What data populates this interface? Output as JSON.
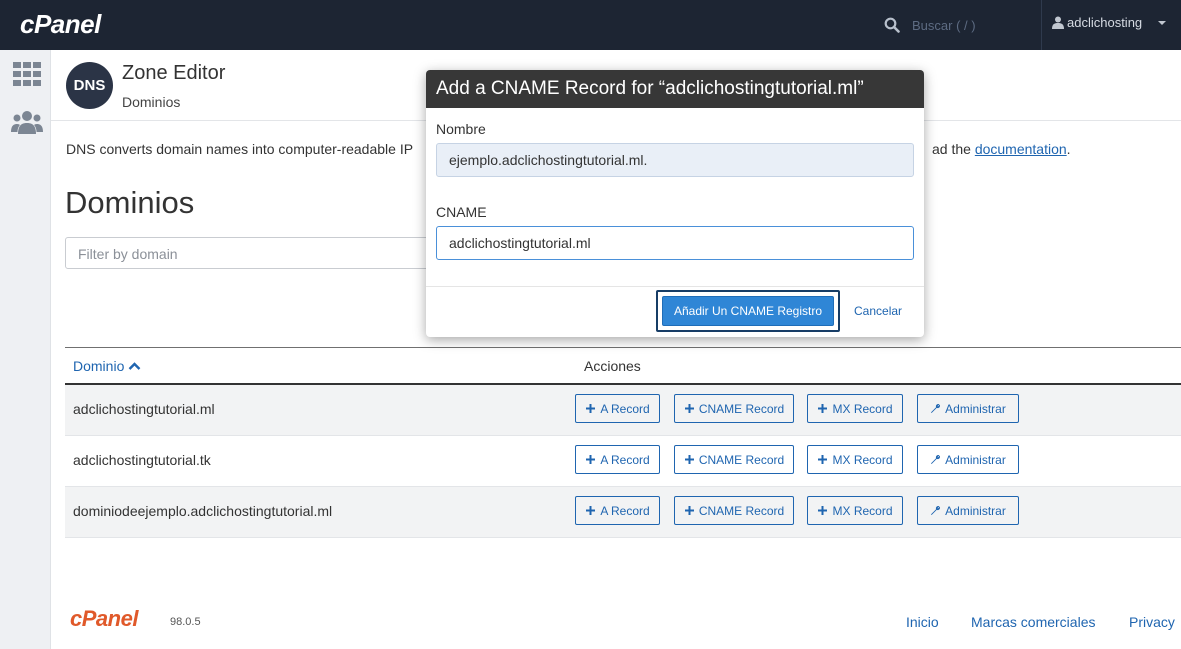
{
  "topbar": {
    "logo": "cPanel",
    "search_placeholder": "Buscar ( / )",
    "username": "adclichosting"
  },
  "sidebar": {
    "items": [
      {
        "icon": "grid-icon"
      },
      {
        "icon": "users-icon"
      }
    ]
  },
  "header": {
    "dns_badge": "DNS",
    "title": "Zone Editor",
    "subtitle": "Dominios"
  },
  "intro": {
    "text_start": "DNS converts domain names into computer-readable IP",
    "text_end_prefix": "ad the ",
    "link": "documentation",
    "text_end_suffix": "."
  },
  "main": {
    "heading": "Dominios",
    "filter_placeholder": "Filter by domain"
  },
  "table": {
    "col_domain": "Dominio",
    "col_actions": "Acciones",
    "actions": {
      "a_record": "A Record",
      "cname_record": "CNAME Record",
      "mx_record": "MX Record",
      "manage": "Administrar"
    },
    "rows": [
      {
        "domain": "adclichostingtutorial.ml"
      },
      {
        "domain": "adclichostingtutorial.tk"
      },
      {
        "domain": "dominiodeejemplo.adclichostingtutorial.ml"
      }
    ]
  },
  "footer": {
    "logo": "cPanel",
    "version": "98.0.5",
    "links": [
      "Inicio",
      "Marcas comerciales",
      "Privacy"
    ]
  },
  "modal": {
    "title": "Add a CNAME Record for “adclichostingtutorial.ml”",
    "name_label": "Nombre",
    "name_value": "ejemplo.adclichostingtutorial.ml.",
    "cname_label": "CNAME",
    "cname_value": "adclichostingtutorial.ml",
    "submit_label": "Añadir Un CNAME Registro",
    "cancel_label": "Cancelar"
  }
}
